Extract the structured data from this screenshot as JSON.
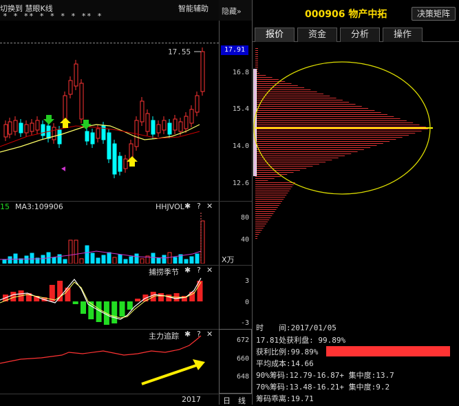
{
  "header": {
    "switch_label": "切换到",
    "indicator_label": "慧眼K线",
    "assist_label": "智能辅助",
    "hide_label": "隐藏",
    "hide_chevron": "»",
    "stars": "*  *   **  *        *  *  *   **  *"
  },
  "stock": {
    "code": "000906",
    "name": "物产中拓",
    "decision_button": "决策矩阵"
  },
  "tabs": [
    "报价",
    "资金",
    "分析",
    "操作"
  ],
  "price_axis": {
    "current": "17.91",
    "ticks": [
      "16.8",
      "15.4",
      "14.0",
      "12.6"
    ],
    "high_marker": "17.55"
  },
  "volume_panel": {
    "left_value": "15",
    "ma3_label": "MA3:109906",
    "indicator": "HHJVOL",
    "ticks": [
      "80",
      "40"
    ],
    "unit": "X万"
  },
  "season_panel": {
    "title": "捕捞季节",
    "ticks": [
      "3",
      "0",
      "-3"
    ]
  },
  "trace_panel": {
    "title": "主力追踪",
    "ticks": [
      "672",
      "660",
      "648"
    ]
  },
  "footer": {
    "year": "2017",
    "period_day": "日",
    "period_line": "线"
  },
  "panel_icons": {
    "gear": "✱",
    "help": "?",
    "close": "✕"
  },
  "cost_distribution": {
    "time_label": "时　　间:",
    "time_value": "2017/01/05",
    "profit_line": "17.81处获利盘: 99.89%",
    "profit_ratio_label": "获利比例:",
    "profit_ratio_value": "99.89%",
    "profit_ratio_fraction": 0.9989,
    "avg_cost": "平均成本:14.66",
    "chip90": "90%筹码:12.79-16.87+ 集中度:13.7",
    "chip70": "70%筹码:13.48-16.21+ 集中度:9.2",
    "divergence": "筹码乖离:19.71"
  },
  "colors": {
    "up": "#ff3333",
    "down": "#00ffff",
    "ma_yellow": "#ffff00",
    "accent_current": "#0000cc",
    "profit_bar": "#ff3333"
  }
}
